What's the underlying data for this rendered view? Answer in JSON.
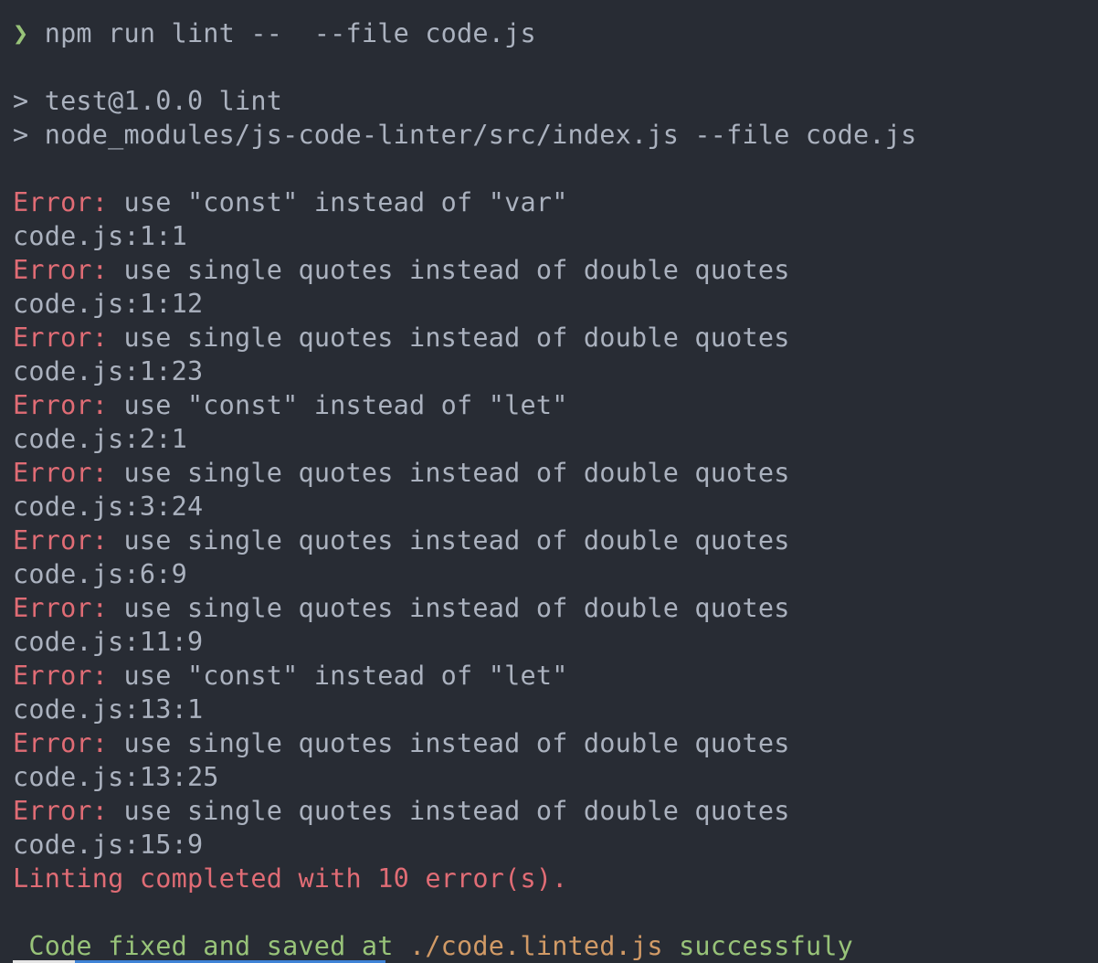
{
  "command": {
    "arrow": "❯",
    "text": "npm run lint --  --file code.js"
  },
  "script_header": [
    "> test@1.0.0 lint",
    "> node_modules/js-code-linter/src/index.js --file code.js"
  ],
  "errors": [
    {
      "label": "Error:",
      "message": " use \"const\" instead of \"var\"",
      "location": "code.js:1:1"
    },
    {
      "label": "Error:",
      "message": " use single quotes instead of double quotes",
      "location": "code.js:1:12"
    },
    {
      "label": "Error:",
      "message": " use single quotes instead of double quotes",
      "location": "code.js:1:23"
    },
    {
      "label": "Error:",
      "message": " use \"const\" instead of \"let\"",
      "location": "code.js:2:1"
    },
    {
      "label": "Error:",
      "message": " use single quotes instead of double quotes",
      "location": "code.js:3:24"
    },
    {
      "label": "Error:",
      "message": " use single quotes instead of double quotes",
      "location": "code.js:6:9"
    },
    {
      "label": "Error:",
      "message": " use single quotes instead of double quotes",
      "location": "code.js:11:9"
    },
    {
      "label": "Error:",
      "message": " use \"const\" instead of \"let\"",
      "location": "code.js:13:1"
    },
    {
      "label": "Error:",
      "message": " use single quotes instead of double quotes",
      "location": "code.js:13:25"
    },
    {
      "label": "Error:",
      "message": " use single quotes instead of double quotes",
      "location": "code.js:15:9"
    }
  ],
  "summary": "Linting completed with 10 error(s).",
  "result": {
    "prefix": " Code fixed and saved at ",
    "path": "./code.linted.js",
    "suffix": " successfuly"
  },
  "colors": {
    "background": "#282c34",
    "foreground": "#abb2bf",
    "error": "#e06c75",
    "success": "#98c379",
    "path": "#d19a66"
  }
}
